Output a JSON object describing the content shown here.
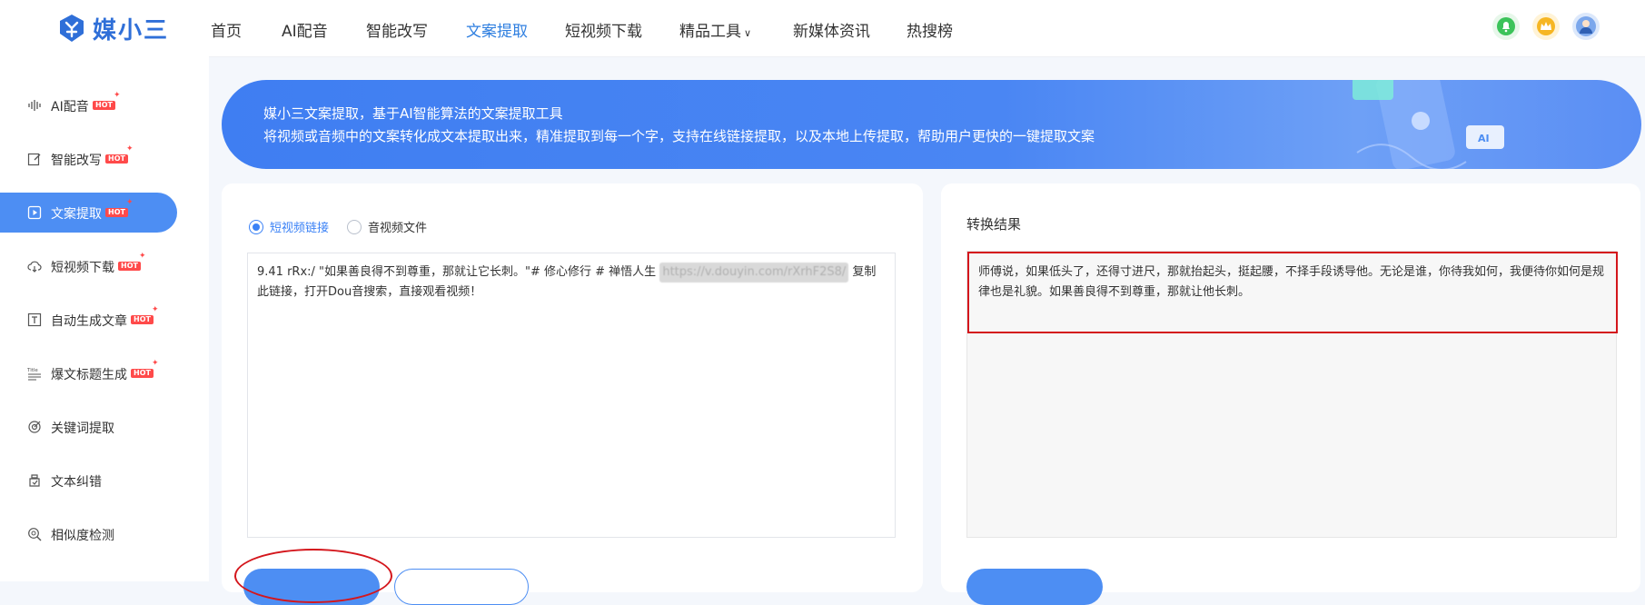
{
  "app": {
    "logo_text": "媒小三"
  },
  "nav": {
    "items": [
      {
        "label": "首页"
      },
      {
        "label": "AI配音"
      },
      {
        "label": "智能改写"
      },
      {
        "label": "文案提取"
      },
      {
        "label": "短视频下载"
      },
      {
        "label": "精品工具"
      },
      {
        "label": "新媒体资讯"
      },
      {
        "label": "热搜榜"
      }
    ]
  },
  "sidebar": {
    "items": [
      {
        "label": "AI配音",
        "badge": "HOT"
      },
      {
        "label": "智能改写",
        "badge": "HOT"
      },
      {
        "label": "文案提取",
        "badge": "HOT"
      },
      {
        "label": "短视频下载",
        "badge": "HOT"
      },
      {
        "label": "自动生成文章",
        "badge": "HOT"
      },
      {
        "label": "爆文标题生成",
        "badge": "HOT"
      },
      {
        "label": "关键词提取"
      },
      {
        "label": "文本纠错"
      },
      {
        "label": "相似度检测"
      }
    ]
  },
  "banner": {
    "title": "媒小三文案提取，基于AI智能算法的文案提取工具",
    "subtitle": "将视频或音频中的文案转化成文本提取出来，精准提取到每一个字，支持在线链接提取，以及本地上传提取，帮助用户更快的一键提取文案"
  },
  "input_panel": {
    "options": [
      {
        "label": "短视频链接",
        "selected": true
      },
      {
        "label": "音视频文件",
        "selected": false
      }
    ],
    "text_before_link": "9.41 rRx:/ \"如果善良得不到尊重，那就让它长刺。\"# 修心修行 # 禅悟人生 ",
    "link_text": "https://v.douyin.com/rXrhF2S8/",
    "text_after_link": " 复制此链接，打开Dou音搜索，直接观看视频！"
  },
  "result_panel": {
    "title": "转换结果",
    "text": "师傅说，如果低头了，还得寸进尺，那就抬起头，挺起腰，不择手段诱导他。无论是谁，你待我如何，我便待你如何是规律也是礼貌。如果善良得不到尊重，那就让他长刺。"
  },
  "colors": {
    "accent": "#4d8ef3",
    "active_nav": "#2f7fe0",
    "annotation": "#d4161c",
    "hot_badge": "#ff4a4a"
  }
}
